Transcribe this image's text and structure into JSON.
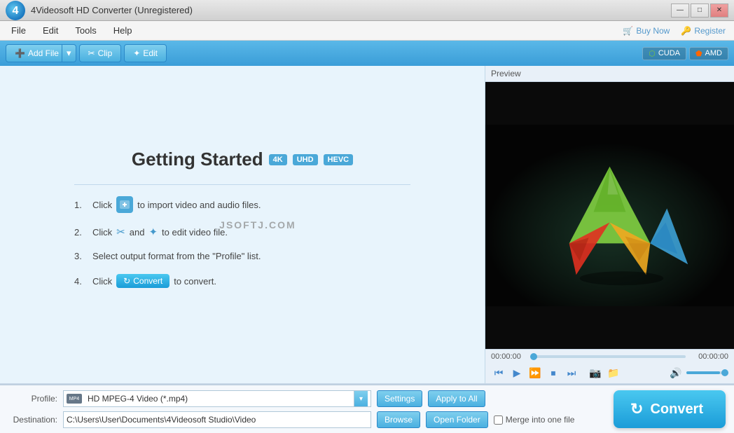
{
  "app": {
    "title": "4Videosoft HD Converter (Unregistered)",
    "logo_text": "4"
  },
  "window_controls": {
    "minimize": "—",
    "maximize": "□",
    "close": "✕"
  },
  "menu": {
    "items": [
      "File",
      "Edit",
      "Tools",
      "Help"
    ]
  },
  "top_actions": {
    "buy_now": "Buy Now",
    "register": "Register"
  },
  "toolbar": {
    "add_file": "Add File",
    "clip": "Clip",
    "edit": "Edit",
    "cuda": "CUDA",
    "amd": "AMD"
  },
  "getting_started": {
    "title": "Getting Started",
    "badges": [
      "4K",
      "UHD",
      "HEVC"
    ],
    "steps": [
      {
        "num": "1.",
        "pre": "Click",
        "icon_type": "add",
        "post": "to import video and audio files."
      },
      {
        "num": "2.",
        "pre": "Click",
        "icon1_type": "scissors",
        "mid": "and",
        "icon2_type": "wand",
        "post": "to edit video file."
      },
      {
        "num": "3.",
        "pre": "Select output format from the \"Profile\" list.",
        "icon_type": null,
        "post": ""
      },
      {
        "num": "4.",
        "pre": "Click",
        "icon_type": "convert",
        "post": "to convert."
      }
    ],
    "convert_mini_label": "Convert",
    "watermark": "JSOFTJ.COM"
  },
  "preview": {
    "label": "Preview"
  },
  "video_controls": {
    "time_start": "00:00:00",
    "time_end": "00:00:00"
  },
  "bottom": {
    "profile_label": "Profile:",
    "profile_value": "HD MPEG-4 Video (*.mp4)",
    "destination_label": "Destination:",
    "destination_value": "C:\\Users\\User\\Documents\\4Videosoft Studio\\Video",
    "settings_btn": "Settings",
    "apply_to_all_btn": "Apply to All",
    "browse_btn": "Browse",
    "open_folder_btn": "Open Folder",
    "merge_label": "Merge into one file",
    "convert_btn": "Convert"
  }
}
